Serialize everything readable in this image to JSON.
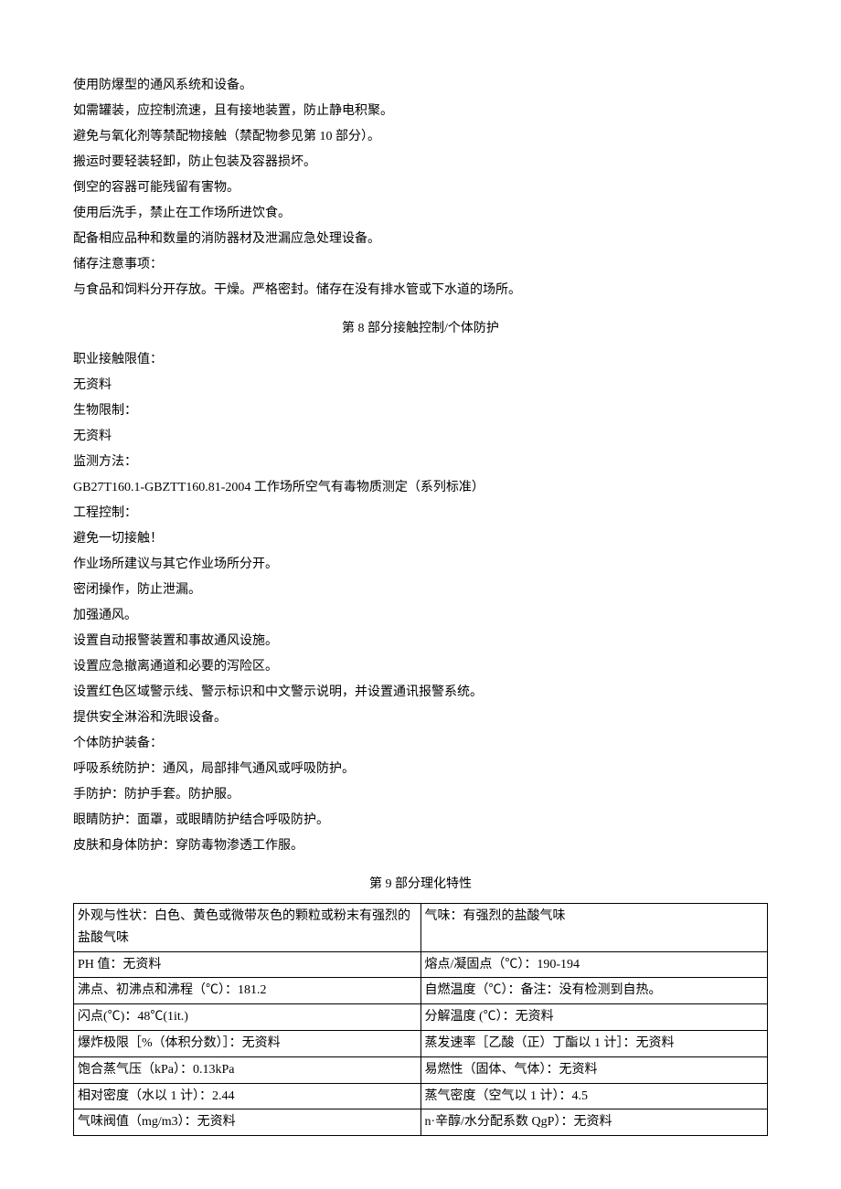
{
  "intro": {
    "l1": "使用防爆型的通风系统和设备。",
    "l2": "如需罐装，应控制流速，且有接地装置，防止静电积聚。",
    "l3": "避免与氧化剂等禁配物接触（禁配物参见第 10 部分）。",
    "l4": "搬运时要轻装轻卸，防止包装及容器损坏。",
    "l5": "倒空的容器可能残留有害物。",
    "l6": "使用后洗手，禁止在工作场所进饮食。",
    "l7": "配备相应品种和数量的消防器材及泄漏应急处理设备。",
    "l8": "储存注意事项：",
    "l9": "与食品和饲料分开存放。干燥。严格密封。储存在没有排水管或下水道的场所。"
  },
  "section8": {
    "title_prefix": "第 ",
    "title_num": "8",
    "title_suffix": " 部分接触控制/个体防护",
    "l1": "职业接触限值：",
    "l2": "无资料",
    "l3": "生物限制：",
    "l4": "无资料",
    "l5": "监测方法：",
    "l6": "GB27T160.1-GBZTT160.81-2004 工作场所空气有毒物质测定（系列标准）",
    "l7": "工程控制：",
    "l8": "避免一切接触！",
    "l9": "作业场所建议与其它作业场所分开。",
    "l10": "密闭操作，防止泄漏。",
    "l11": "加强通风。",
    "l12": "设置自动报警装置和事故通风设施。",
    "l13": "设置应急撤离通道和必要的泻险区。",
    "l14": "设置红色区域警示线、警示标识和中文警示说明，并设置通讯报警系统。",
    "l15": "提供安全淋浴和洗眼设备。",
    "l16": "个体防护装备：",
    "l17": "呼吸系统防护：通风，局部排气通风或呼吸防护。",
    "l18": "手防护：防护手套。防护服。",
    "l19": "眼睛防护：面罩，或眼睛防护结合呼吸防护。",
    "l20": "皮肤和身体防护：穿防毒物渗透工作服。"
  },
  "section9": {
    "title_prefix": "第 ",
    "title_num": "9",
    "title_suffix": " 部分理化特性",
    "r1c1": "外观与性状：白色、黄色或微带灰色的颗粒或粉末有强烈的盐酸气味",
    "r1c2": "气味：有强烈的盐酸气味",
    "r2c1": "PH 值：无资料",
    "r2c2": "熔点/凝固点（℃）：190-194",
    "r3c1": "沸点、初沸点和沸程（℃）：181.2",
    "r3c2": "自燃温度（℃）：备注：没有检测到自热。",
    "r4c1": "闪点(℃)：48℃(1it.)",
    "r4c2": "分解温度 (℃）：无资料",
    "r5c1": "爆炸极限［%（体积分数）］：无资料",
    "r5c2": "蒸发速率［乙酸（正）丁酯以 1 计］：无资料",
    "r6c1": "饱合蒸气压（kPa）：0.13kPa",
    "r6c2": "易燃性（固体、气体）：无资料",
    "r7c1": "相对密度（水以 1 计）：2.44",
    "r7c2": "蒸气密度（空气以 1 计）：4.5",
    "r8c1": "气味阀值（mg/m3）：无资料",
    "r8c2": "n·辛醇/水分配系数 QgP）：无资料"
  }
}
